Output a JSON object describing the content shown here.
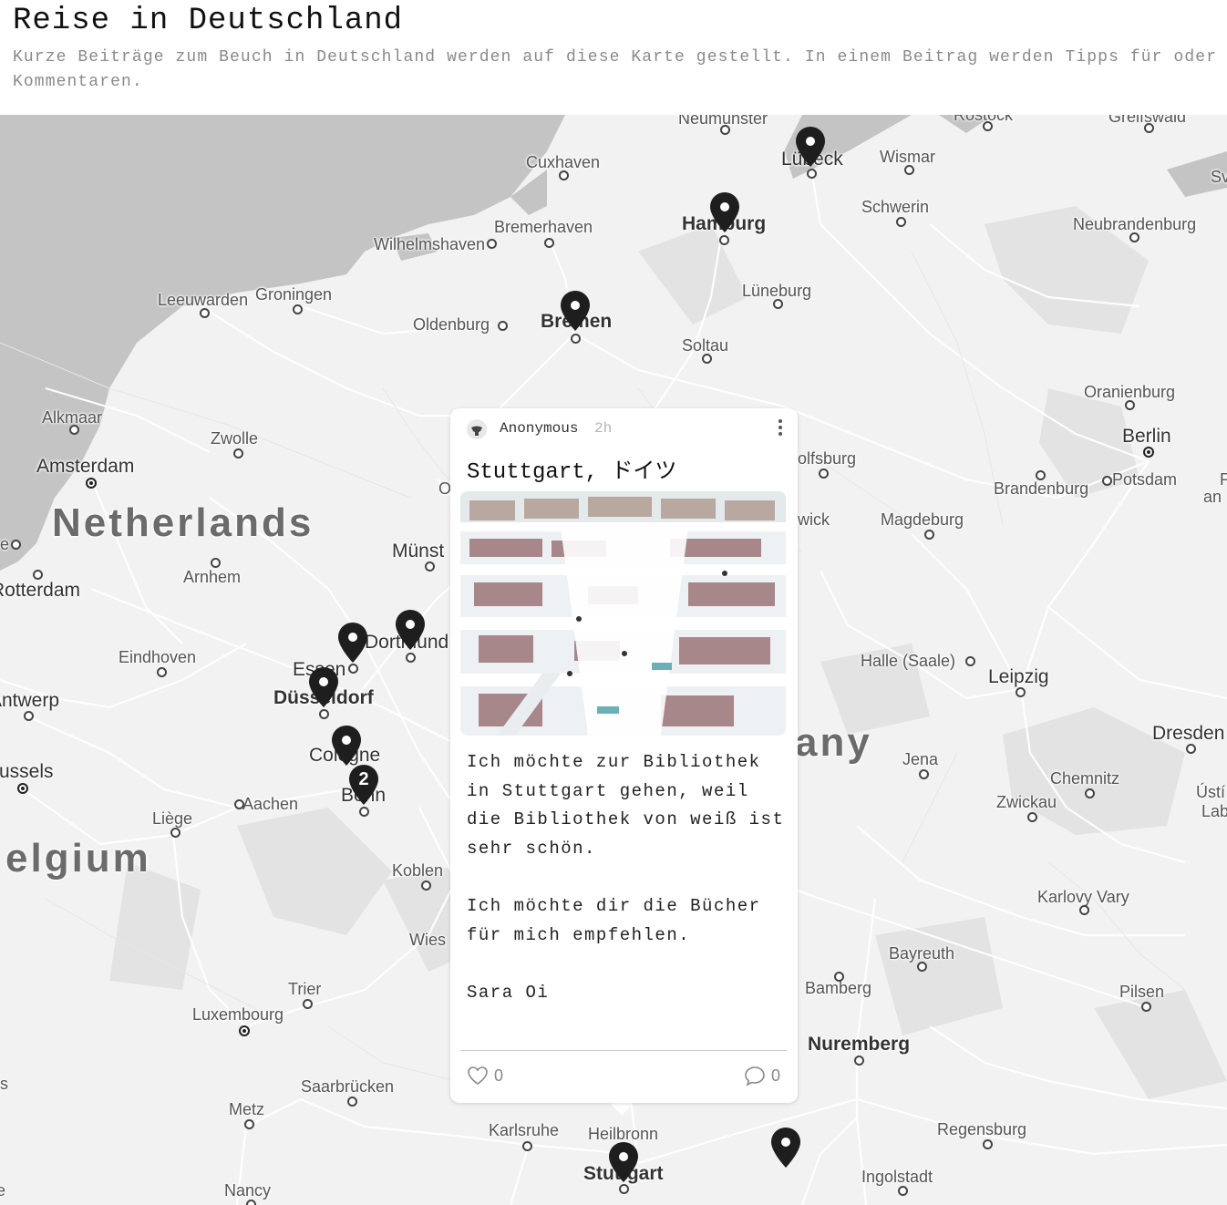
{
  "header": {
    "title": "Reise in Deutschland",
    "description": "Kurze Beiträge zum Beuch in Deutschland werden auf diese Karte gestellt. In einem Beitrag werden Tipps für oder Kommentaren."
  },
  "map": {
    "places": {
      "neumunster": "Neumunster",
      "rostock": "Rostock",
      "greifswald": "Greifswald",
      "cuxhaven": "Cuxhaven",
      "lubeck": "Lübeck",
      "wismar": "Wismar",
      "sw": "Sv",
      "hamburg": "Hamburg",
      "bremerhaven": "Bremerhaven",
      "schwerin": "Schwerin",
      "neubrandenburg": "Neubrandenburg",
      "wilhelmshaven": "Wilhelmshaven",
      "leeuwarden": "Leeuwarden",
      "groningen": "Groningen",
      "luneburg": "Lüneburg",
      "oldenburg": "Oldenburg",
      "bremen": "Bremen",
      "soltau": "Soltau",
      "oranienburg": "Oranienburg",
      "alkmaar": "Alkmaar",
      "zwolle": "Zwolle",
      "berlin": "Berlin",
      "amsterdam": "Amsterdam",
      "wolfsburg": "olfsburg",
      "brandenburg": "Brandenburg",
      "potsdam": "Potsdam",
      "pl": "P",
      "an": "an",
      "osnabruck": "O",
      "netherlands": "Netherlands",
      "braunschweig": "wick",
      "magdeburg": "Magdeburg",
      "hague": "e",
      "munster": "Münst",
      "arnhem": "Arnhem",
      "rotterdam": "Rotterdam",
      "dortmund": "Dortmund",
      "eindhoven": "Eindhoven",
      "essen": "Essen",
      "halle": "Halle (Saale)",
      "leipzig": "Leipzig",
      "antwerp": "Antwerp",
      "dusseldorf": "Düsseldorf",
      "germany": "any",
      "dresden": "Dresden",
      "cologne": "Cologne",
      "jena": "Jena",
      "brussels": "russels",
      "chemnitz": "Chemnitz",
      "usti": "Ústí",
      "usti2": "Lab",
      "aachen": "Aachen",
      "bonn": "Bonn",
      "zwickau": "Zwickau",
      "liege": "Liège",
      "belgium": "elgium",
      "koblenz": "Koblen",
      "karlovy": "Karlovy Vary",
      "wiesbaden": "Wies",
      "bayreuth": "Bayreuth",
      "trier": "Trier",
      "bamberg": "Bamberg",
      "pilsen": "Pilsen",
      "luxembourg": "Luxembourg",
      "nuremberg": "Nuremberg",
      "saarbrucken": "Saarbrücken",
      "s_left": "s",
      "metz": "Metz",
      "regensburg": "Regensburg",
      "karlsruhe": "Karlsruhe",
      "heilbronn": "Heilbronn",
      "stuttgart": "Stuttgart",
      "ingolstadt": "Ingolstadt",
      "nancy": "Nancy",
      "e_left": "e"
    },
    "cluster_count": "2"
  },
  "post": {
    "author": "Anonymous",
    "time": "2h",
    "title": "Stuttgart, ドイツ",
    "body": "Ich möchte zur Bibliothek\nin Stuttgart gehen, weil\ndie Bibliothek von weiß ist\nsehr schön.\n\nIch möchte dir die Bücher\nfür mich empfehlen.\n\nSara Oi",
    "likes": "0",
    "comments": "0"
  },
  "icons": {
    "pin": "map-pin-icon",
    "menu": "more-vertical-icon",
    "like": "heart-icon",
    "comment": "comment-icon",
    "avatar": "user-avatar-icon"
  },
  "colors": {
    "water": "#c4c4c4",
    "land": "#f2f2f2",
    "pin": "#1e1e1e"
  }
}
